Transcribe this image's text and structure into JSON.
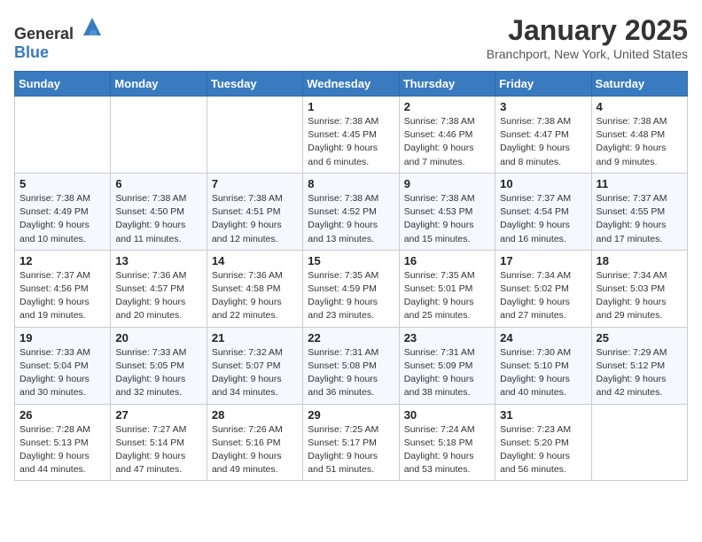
{
  "header": {
    "logo_general": "General",
    "logo_blue": "Blue",
    "title": "January 2025",
    "subtitle": "Branchport, New York, United States"
  },
  "weekdays": [
    "Sunday",
    "Monday",
    "Tuesday",
    "Wednesday",
    "Thursday",
    "Friday",
    "Saturday"
  ],
  "weeks": [
    [
      {
        "day": "",
        "info": ""
      },
      {
        "day": "",
        "info": ""
      },
      {
        "day": "",
        "info": ""
      },
      {
        "day": "1",
        "info": "Sunrise: 7:38 AM\nSunset: 4:45 PM\nDaylight: 9 hours and 6 minutes."
      },
      {
        "day": "2",
        "info": "Sunrise: 7:38 AM\nSunset: 4:46 PM\nDaylight: 9 hours and 7 minutes."
      },
      {
        "day": "3",
        "info": "Sunrise: 7:38 AM\nSunset: 4:47 PM\nDaylight: 9 hours and 8 minutes."
      },
      {
        "day": "4",
        "info": "Sunrise: 7:38 AM\nSunset: 4:48 PM\nDaylight: 9 hours and 9 minutes."
      }
    ],
    [
      {
        "day": "5",
        "info": "Sunrise: 7:38 AM\nSunset: 4:49 PM\nDaylight: 9 hours and 10 minutes."
      },
      {
        "day": "6",
        "info": "Sunrise: 7:38 AM\nSunset: 4:50 PM\nDaylight: 9 hours and 11 minutes."
      },
      {
        "day": "7",
        "info": "Sunrise: 7:38 AM\nSunset: 4:51 PM\nDaylight: 9 hours and 12 minutes."
      },
      {
        "day": "8",
        "info": "Sunrise: 7:38 AM\nSunset: 4:52 PM\nDaylight: 9 hours and 13 minutes."
      },
      {
        "day": "9",
        "info": "Sunrise: 7:38 AM\nSunset: 4:53 PM\nDaylight: 9 hours and 15 minutes."
      },
      {
        "day": "10",
        "info": "Sunrise: 7:37 AM\nSunset: 4:54 PM\nDaylight: 9 hours and 16 minutes."
      },
      {
        "day": "11",
        "info": "Sunrise: 7:37 AM\nSunset: 4:55 PM\nDaylight: 9 hours and 17 minutes."
      }
    ],
    [
      {
        "day": "12",
        "info": "Sunrise: 7:37 AM\nSunset: 4:56 PM\nDaylight: 9 hours and 19 minutes."
      },
      {
        "day": "13",
        "info": "Sunrise: 7:36 AM\nSunset: 4:57 PM\nDaylight: 9 hours and 20 minutes."
      },
      {
        "day": "14",
        "info": "Sunrise: 7:36 AM\nSunset: 4:58 PM\nDaylight: 9 hours and 22 minutes."
      },
      {
        "day": "15",
        "info": "Sunrise: 7:35 AM\nSunset: 4:59 PM\nDaylight: 9 hours and 23 minutes."
      },
      {
        "day": "16",
        "info": "Sunrise: 7:35 AM\nSunset: 5:01 PM\nDaylight: 9 hours and 25 minutes."
      },
      {
        "day": "17",
        "info": "Sunrise: 7:34 AM\nSunset: 5:02 PM\nDaylight: 9 hours and 27 minutes."
      },
      {
        "day": "18",
        "info": "Sunrise: 7:34 AM\nSunset: 5:03 PM\nDaylight: 9 hours and 29 minutes."
      }
    ],
    [
      {
        "day": "19",
        "info": "Sunrise: 7:33 AM\nSunset: 5:04 PM\nDaylight: 9 hours and 30 minutes."
      },
      {
        "day": "20",
        "info": "Sunrise: 7:33 AM\nSunset: 5:05 PM\nDaylight: 9 hours and 32 minutes."
      },
      {
        "day": "21",
        "info": "Sunrise: 7:32 AM\nSunset: 5:07 PM\nDaylight: 9 hours and 34 minutes."
      },
      {
        "day": "22",
        "info": "Sunrise: 7:31 AM\nSunset: 5:08 PM\nDaylight: 9 hours and 36 minutes."
      },
      {
        "day": "23",
        "info": "Sunrise: 7:31 AM\nSunset: 5:09 PM\nDaylight: 9 hours and 38 minutes."
      },
      {
        "day": "24",
        "info": "Sunrise: 7:30 AM\nSunset: 5:10 PM\nDaylight: 9 hours and 40 minutes."
      },
      {
        "day": "25",
        "info": "Sunrise: 7:29 AM\nSunset: 5:12 PM\nDaylight: 9 hours and 42 minutes."
      }
    ],
    [
      {
        "day": "26",
        "info": "Sunrise: 7:28 AM\nSunset: 5:13 PM\nDaylight: 9 hours and 44 minutes."
      },
      {
        "day": "27",
        "info": "Sunrise: 7:27 AM\nSunset: 5:14 PM\nDaylight: 9 hours and 47 minutes."
      },
      {
        "day": "28",
        "info": "Sunrise: 7:26 AM\nSunset: 5:16 PM\nDaylight: 9 hours and 49 minutes."
      },
      {
        "day": "29",
        "info": "Sunrise: 7:25 AM\nSunset: 5:17 PM\nDaylight: 9 hours and 51 minutes."
      },
      {
        "day": "30",
        "info": "Sunrise: 7:24 AM\nSunset: 5:18 PM\nDaylight: 9 hours and 53 minutes."
      },
      {
        "day": "31",
        "info": "Sunrise: 7:23 AM\nSunset: 5:20 PM\nDaylight: 9 hours and 56 minutes."
      },
      {
        "day": "",
        "info": ""
      }
    ]
  ]
}
